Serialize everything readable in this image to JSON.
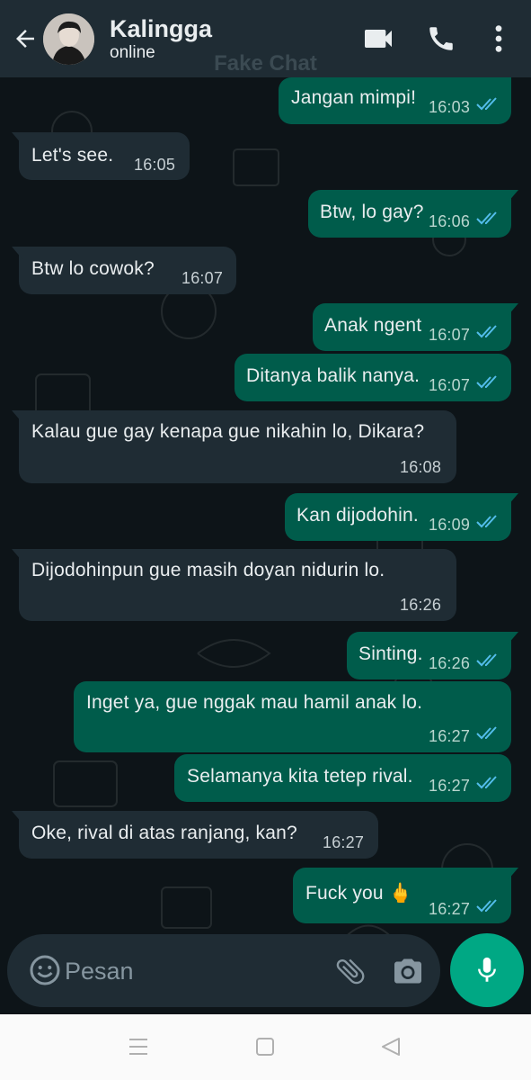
{
  "header": {
    "contact_name": "Kalingga",
    "status": "online",
    "back_icon": "arrow-left-icon",
    "video_icon": "video-call-icon",
    "phone_icon": "phone-icon",
    "menu_icon": "more-vert-icon"
  },
  "watermark": "Fake Chat",
  "messages": [
    {
      "dir": "out",
      "text": "Jangan mimpi!",
      "time": "16:03"
    },
    {
      "dir": "in",
      "text": "Let's see.",
      "time": "16:05"
    },
    {
      "dir": "out",
      "text": "Btw, lo gay?",
      "time": "16:06"
    },
    {
      "dir": "in",
      "text": "Btw lo cowok?",
      "time": "16:07"
    },
    {
      "dir": "out",
      "text": "Anak ngent",
      "time": "16:07"
    },
    {
      "dir": "out",
      "text": "Ditanya balik nanya.",
      "time": "16:07"
    },
    {
      "dir": "in",
      "text": "Kalau gue gay kenapa gue nikahin lo, Dikara?",
      "time": "16:08"
    },
    {
      "dir": "out",
      "text": "Kan dijodohin.",
      "time": "16:09"
    },
    {
      "dir": "in",
      "text": "Dijodohinpun gue masih doyan nidurin lo.",
      "time": "16:26"
    },
    {
      "dir": "out",
      "text": "Sinting.",
      "time": "16:26"
    },
    {
      "dir": "out",
      "text": "Inget ya, gue nggak mau hamil anak lo.",
      "time": "16:27"
    },
    {
      "dir": "out",
      "text": "Selamanya kita tetep rival.",
      "time": "16:27"
    },
    {
      "dir": "in",
      "text": "Oke, rival di atas ranjang, kan?",
      "time": "16:27"
    },
    {
      "dir": "out",
      "text": "Fuck you 🖕",
      "time": "16:27"
    }
  ],
  "input": {
    "placeholder": "Pesan",
    "emoji_icon": "emoji-icon",
    "attach_icon": "paperclip-icon",
    "camera_icon": "camera-icon",
    "mic_icon": "microphone-icon"
  },
  "nav": {
    "menu_icon": "nav-menu-icon",
    "home_icon": "nav-home-icon",
    "back_icon": "nav-back-icon"
  },
  "colors": {
    "header_bg": "#1f2c34",
    "chat_bg": "#0d1418",
    "incoming_bubble": "#1f2c34",
    "outgoing_bubble": "#005c4b",
    "read_ticks": "#53bdeb",
    "mic_button": "#00a884"
  }
}
